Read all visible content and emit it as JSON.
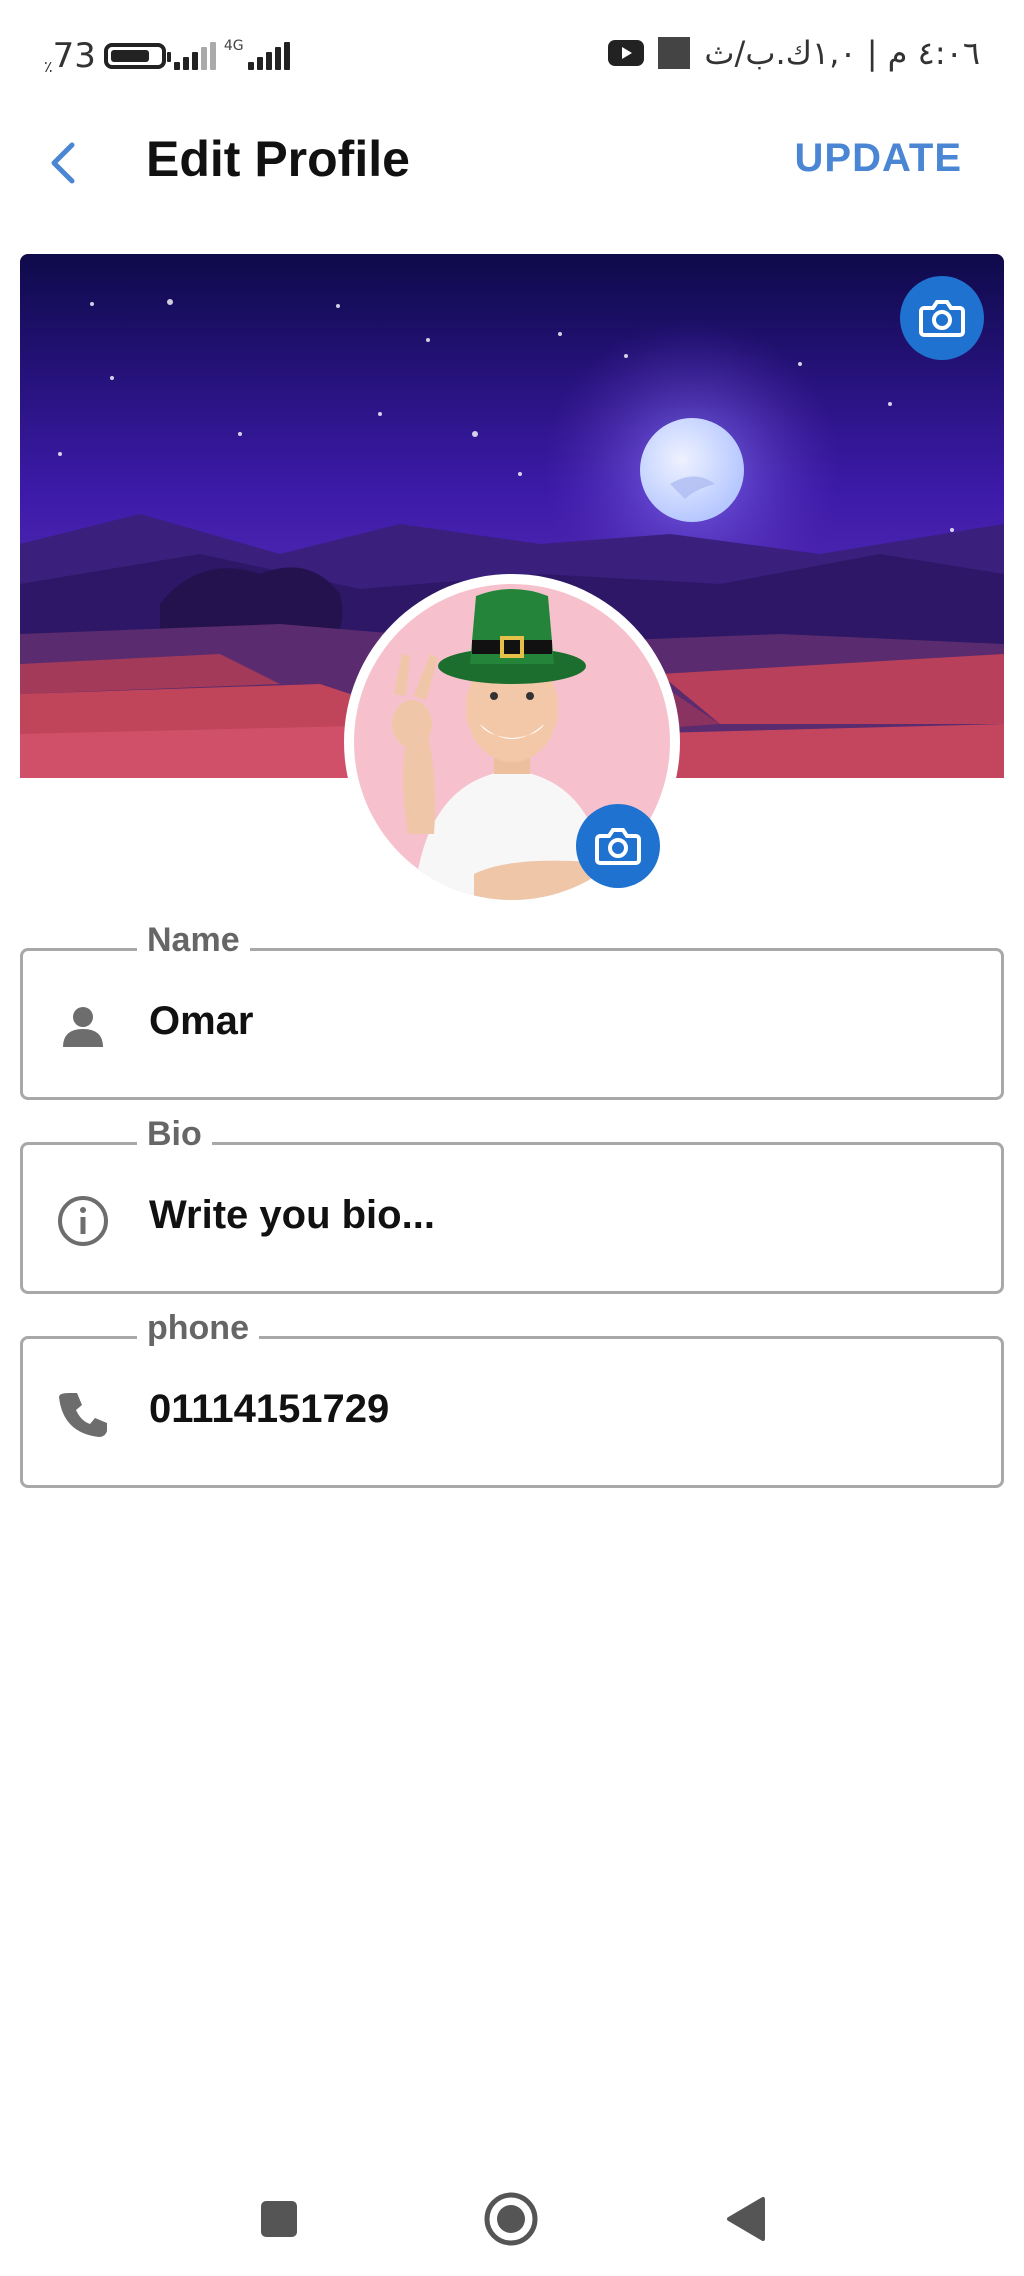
{
  "status_bar": {
    "battery_percent": "73",
    "battery_symbol": "٪",
    "network_type": "4G",
    "right_text": "٤:٠٦ م | ١,٠ك.ب/ث"
  },
  "app_bar": {
    "title": "Edit Profile",
    "update_label": "UPDATE"
  },
  "fields": {
    "name": {
      "label": "Name",
      "value": "Omar",
      "icon": "person-icon"
    },
    "bio": {
      "label": "Bio",
      "placeholder": "Write you bio...",
      "icon": "info-icon"
    },
    "phone": {
      "label": "phone",
      "value": "01114151729",
      "icon": "phone-icon"
    }
  },
  "colors": {
    "accent": "#4a86d4",
    "camera_button": "#1f72d0",
    "border": "#a8a8a8",
    "label": "#666666"
  }
}
